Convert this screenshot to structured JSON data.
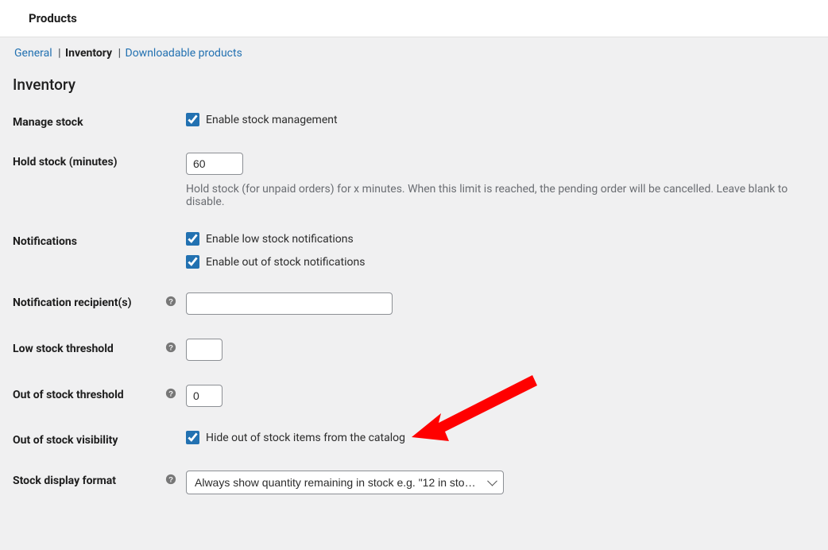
{
  "header": {
    "title": "Products"
  },
  "subnav": {
    "general": "General",
    "inventory": "Inventory",
    "downloadable": "Downloadable products"
  },
  "page": {
    "heading": "Inventory"
  },
  "fields": {
    "manage_stock": {
      "label": "Manage stock",
      "checkbox_label": "Enable stock management",
      "checked": true
    },
    "hold_stock": {
      "label": "Hold stock (minutes)",
      "value": "60",
      "description": "Hold stock (for unpaid orders) for x minutes. When this limit is reached, the pending order will be cancelled. Leave blank to disable."
    },
    "notifications": {
      "label": "Notifications",
      "low_label": "Enable low stock notifications",
      "low_checked": true,
      "out_label": "Enable out of stock notifications",
      "out_checked": true
    },
    "recipients": {
      "label": "Notification recipient(s)",
      "value": ""
    },
    "low_threshold": {
      "label": "Low stock threshold",
      "value": ""
    },
    "out_threshold": {
      "label": "Out of stock threshold",
      "value": "0"
    },
    "out_visibility": {
      "label": "Out of stock visibility",
      "checkbox_label": "Hide out of stock items from the catalog",
      "checked": true
    },
    "stock_display": {
      "label": "Stock display format",
      "selected": "Always show quantity remaining in stock e.g. \"12 in sto…"
    }
  }
}
